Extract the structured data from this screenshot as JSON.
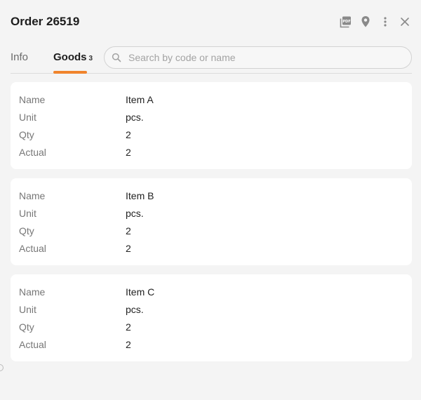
{
  "header": {
    "title": "Order 26519",
    "icons": [
      "pdf-icon",
      "location-pin-icon",
      "more-vertical-icon",
      "close-icon"
    ]
  },
  "tabs": [
    {
      "label": "Info"
    },
    {
      "label": "Goods",
      "count": "3"
    }
  ],
  "search": {
    "placeholder": "Search by code or name",
    "value": ""
  },
  "items": [
    {
      "name_label": "Name",
      "name": "Item A",
      "unit_label": "Unit",
      "unit": "pcs.",
      "qty_label": "Qty",
      "qty": "2",
      "actual_label": "Actual",
      "actual": "2"
    },
    {
      "name_label": "Name",
      "name": "Item B",
      "unit_label": "Unit",
      "unit": "pcs.",
      "qty_label": "Qty",
      "qty": "2",
      "actual_label": "Actual",
      "actual": "2"
    },
    {
      "name_label": "Name",
      "name": "Item C",
      "unit_label": "Unit",
      "unit": "pcs.",
      "qty_label": "Qty",
      "qty": "2",
      "actual_label": "Actual",
      "actual": "2"
    }
  ],
  "colors": {
    "accent": "#f0842c",
    "background": "#f4f4f4",
    "card": "#ffffff"
  }
}
